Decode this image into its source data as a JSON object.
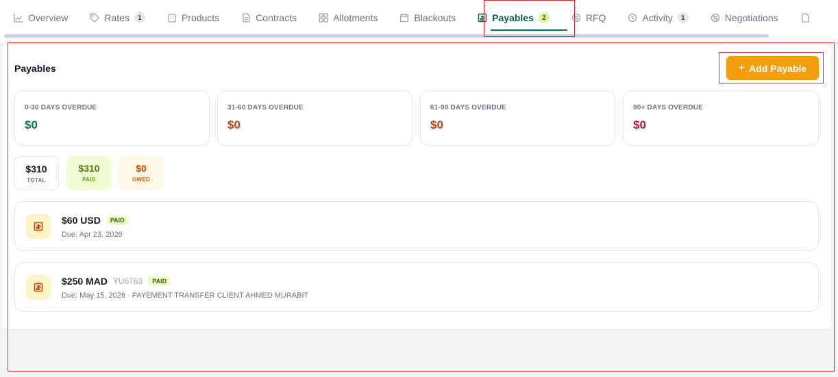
{
  "tabs": [
    {
      "label": "Overview",
      "count": "",
      "icon": "chart-line-icon"
    },
    {
      "label": "Rates",
      "count": "1",
      "icon": "tag-icon"
    },
    {
      "label": "Products",
      "count": "",
      "icon": "building-icon"
    },
    {
      "label": "Contracts",
      "count": "",
      "icon": "document-icon"
    },
    {
      "label": "Allotments",
      "count": "",
      "icon": "grid-icon"
    },
    {
      "label": "Blackouts",
      "count": "",
      "icon": "calendar-icon"
    },
    {
      "label": "Payables",
      "count": "2",
      "icon": "receipt-icon"
    },
    {
      "label": "RFQ",
      "count": "",
      "icon": "rfq-icon"
    },
    {
      "label": "Activity",
      "count": "1",
      "icon": "clock-icon"
    },
    {
      "label": "Negotiations",
      "count": "",
      "icon": "percent-icon"
    }
  ],
  "section": {
    "title": "Payables",
    "add_label": "Add Payable",
    "add_icon": "plus-icon"
  },
  "aging": [
    {
      "label": "0-30 DAYS OVERDUE",
      "value": "$0",
      "color": "#047857"
    },
    {
      "label": "31-60 DAYS OVERDUE",
      "value": "$0",
      "color": "#c2410c"
    },
    {
      "label": "61-90 DAYS OVERDUE",
      "value": "$0",
      "color": "#c2410c"
    },
    {
      "label": "90+ DAYS OVERDUE",
      "value": "$0",
      "color": "#be123c"
    }
  ],
  "summary": {
    "total": {
      "amount": "$310",
      "label": "TOTAL"
    },
    "paid": {
      "amount": "$310",
      "label": "PAID"
    },
    "owed": {
      "amount": "$0",
      "label": "OWED"
    }
  },
  "payables": [
    {
      "amount": "$60 USD",
      "ref": "",
      "status": "PAID",
      "due": "Due: Apr 23, 2026"
    },
    {
      "amount": "$250 MAD",
      "ref": "YU6763",
      "status": "PAID",
      "due": "Due: May 15, 2026 · PAYEMENT TRANSFER CLIENT AHMED MURABIT"
    }
  ],
  "colors": {
    "accent": "#f59e0b",
    "active_tab": "#047857",
    "highlight": "#dc2626"
  }
}
